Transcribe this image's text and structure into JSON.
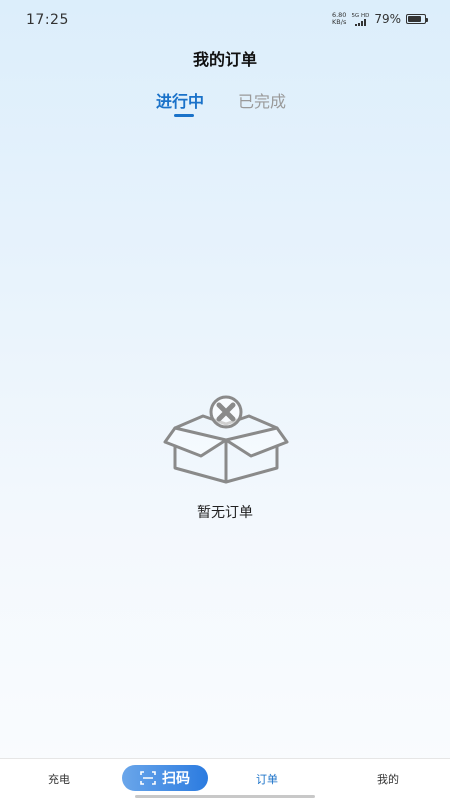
{
  "status_bar": {
    "time": "17:25",
    "net_speed_value": "6.80",
    "net_speed_unit": "KB/s",
    "signal_label": "5G HD",
    "battery": "79%",
    "battery_level": 0.79
  },
  "header": {
    "title": "我的订单"
  },
  "tabs": [
    {
      "label": "进行中",
      "active": true
    },
    {
      "label": "已完成",
      "active": false
    }
  ],
  "empty_state": {
    "icon": "empty-box-icon",
    "text": "暂无订单"
  },
  "bottom_nav": {
    "items": [
      {
        "label": "充电"
      },
      {
        "label": "扫码",
        "icon": "scan-icon"
      },
      {
        "label": "订单",
        "active": true
      },
      {
        "label": "我的"
      }
    ]
  },
  "colors": {
    "accent": "#1a72c9",
    "inactive_tab": "#9a9a9a",
    "scan_gradient_start": "#6aa6ea",
    "scan_gradient_end": "#2b7be0"
  }
}
